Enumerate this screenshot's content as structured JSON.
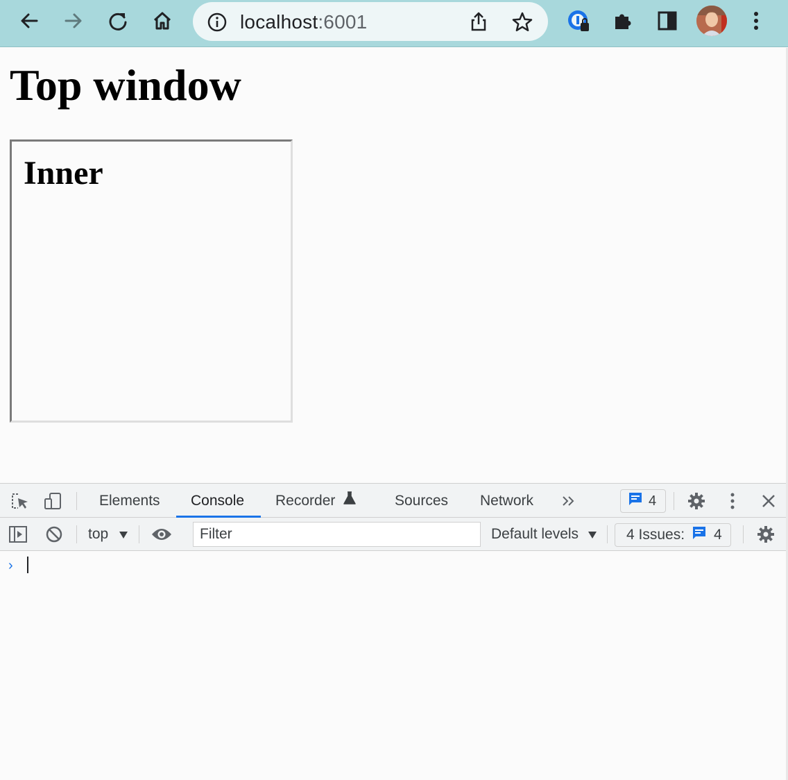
{
  "browser": {
    "url_host": "localhost",
    "url_port": ":6001",
    "accent": "#a8d8dc",
    "icons": [
      "back-icon",
      "forward-icon",
      "reload-icon",
      "home-icon",
      "info-icon",
      "share-icon",
      "star-icon",
      "password-manager-icon",
      "extensions-icon",
      "side-panel-icon",
      "avatar",
      "more-icon"
    ]
  },
  "page": {
    "title": "Top window",
    "iframe": {
      "title": "Inner"
    }
  },
  "devtools": {
    "tabs": [
      {
        "label": "Elements"
      },
      {
        "label": "Console"
      },
      {
        "label": "Recorder"
      },
      {
        "label": "Sources"
      },
      {
        "label": "Network"
      }
    ],
    "active_tab": "Console",
    "message_count": "4",
    "console": {
      "context": "top",
      "filter_placeholder": "Filter",
      "levels": "Default levels",
      "issues_label": "4 Issues:",
      "issues_count": "4",
      "prompt": "›"
    },
    "accent": "#1a73e8"
  }
}
